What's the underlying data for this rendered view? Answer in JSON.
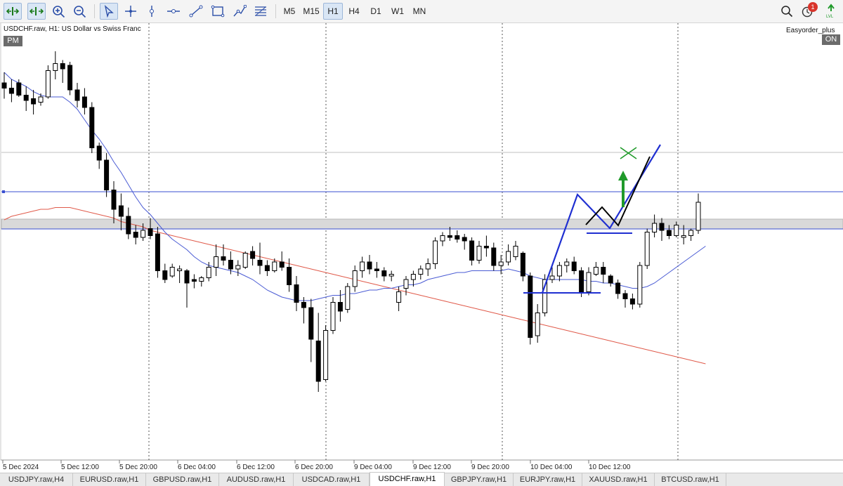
{
  "toolbar": {
    "tools": [
      {
        "name": "autoscroll-icon"
      },
      {
        "name": "chart-shift-icon"
      },
      {
        "name": "zoom-in-icon"
      },
      {
        "name": "zoom-out-icon"
      },
      {
        "name": "cursor-icon"
      },
      {
        "name": "crosshair-icon"
      },
      {
        "name": "vertical-line-icon"
      },
      {
        "name": "horizontal-line-icon"
      },
      {
        "name": "trendline-icon"
      },
      {
        "name": "rectangle-icon"
      },
      {
        "name": "polyline-icon"
      },
      {
        "name": "fibonacci-icon"
      }
    ],
    "timeframes": [
      "M5",
      "M15",
      "H1",
      "H4",
      "D1",
      "W1",
      "MN"
    ],
    "active_timeframe": "H1",
    "notification_count": "1"
  },
  "chart": {
    "title": "USDCHF.raw, H1:  US Dollar vs Swiss Franc",
    "session_badge": "PM",
    "expert_name": "Easyorder_plus",
    "expert_status": "ON",
    "time_labels": [
      "5 Dec 2024",
      "5 Dec 12:00",
      "5 Dec 20:00",
      "6 Dec 04:00",
      "6 Dec 12:00",
      "6 Dec 20:00",
      "9 Dec 04:00",
      "9 Dec 12:00",
      "9 Dec 20:00",
      "10 Dec 04:00",
      "10 Dec 12:00"
    ]
  },
  "tabs": [
    "USDJPY.raw,H4",
    "EURUSD.raw,H1",
    "GBPUSD.raw,H1",
    "AUDUSD.raw,H1",
    "USDCAD.raw,H1",
    "USDCHF.raw,H1",
    "GBPJPY.raw,H1",
    "EURJPY.raw,H1",
    "XAUUSD.raw,H1",
    "BTCUSD.raw,H1"
  ],
  "active_tab": "USDCHF.raw,H1",
  "colors": {
    "bull": "#ffffff",
    "bear": "#000000",
    "fast_ma": "#4a5bd4",
    "slow_ma": "#e05a4a",
    "h_level": "#3a4fd0",
    "zone_fill": "#d9d9d9",
    "drawing_blue": "#1f2fd1",
    "drawing_black": "#000000",
    "target_green": "#1f9a2a"
  },
  "chart_data": {
    "type": "candlestick",
    "symbol": "USDCHF.raw",
    "timeframe": "H1",
    "candles": [
      {
        "o": 0.8826,
        "h": 0.8832,
        "l": 0.8817,
        "c": 0.8823
      },
      {
        "o": 0.8823,
        "h": 0.8828,
        "l": 0.8815,
        "c": 0.882
      },
      {
        "o": 0.8826,
        "h": 0.8828,
        "l": 0.8818,
        "c": 0.8819
      },
      {
        "o": 0.8819,
        "h": 0.8824,
        "l": 0.881,
        "c": 0.8816
      },
      {
        "o": 0.8817,
        "h": 0.8822,
        "l": 0.8808,
        "c": 0.8814
      },
      {
        "o": 0.8815,
        "h": 0.882,
        "l": 0.8813,
        "c": 0.8818
      },
      {
        "o": 0.8818,
        "h": 0.8836,
        "l": 0.8817,
        "c": 0.8833
      },
      {
        "o": 0.8833,
        "h": 0.8844,
        "l": 0.8828,
        "c": 0.8837
      },
      {
        "o": 0.8837,
        "h": 0.8839,
        "l": 0.8826,
        "c": 0.8834
      },
      {
        "o": 0.8836,
        "h": 0.8838,
        "l": 0.8819,
        "c": 0.8822
      },
      {
        "o": 0.8822,
        "h": 0.8826,
        "l": 0.8812,
        "c": 0.8816
      },
      {
        "o": 0.8818,
        "h": 0.8823,
        "l": 0.8808,
        "c": 0.8812
      },
      {
        "o": 0.8812,
        "h": 0.8815,
        "l": 0.8786,
        "c": 0.8789
      },
      {
        "o": 0.879,
        "h": 0.8792,
        "l": 0.8777,
        "c": 0.8782
      },
      {
        "o": 0.8782,
        "h": 0.8786,
        "l": 0.8761,
        "c": 0.8765
      },
      {
        "o": 0.8765,
        "h": 0.877,
        "l": 0.8746,
        "c": 0.8754
      },
      {
        "o": 0.8756,
        "h": 0.8763,
        "l": 0.8742,
        "c": 0.875
      },
      {
        "o": 0.875,
        "h": 0.8755,
        "l": 0.8737,
        "c": 0.874
      },
      {
        "o": 0.8741,
        "h": 0.8745,
        "l": 0.8734,
        "c": 0.8738
      },
      {
        "o": 0.8738,
        "h": 0.8746,
        "l": 0.8736,
        "c": 0.8742
      },
      {
        "o": 0.8743,
        "h": 0.8749,
        "l": 0.8737,
        "c": 0.8739
      },
      {
        "o": 0.874,
        "h": 0.8744,
        "l": 0.8715,
        "c": 0.8719
      },
      {
        "o": 0.8719,
        "h": 0.8723,
        "l": 0.8712,
        "c": 0.8714
      },
      {
        "o": 0.8716,
        "h": 0.8723,
        "l": 0.8715,
        "c": 0.8721
      },
      {
        "o": 0.8719,
        "h": 0.8722,
        "l": 0.8712,
        "c": 0.872
      },
      {
        "o": 0.8719,
        "h": 0.872,
        "l": 0.8698,
        "c": 0.8712
      },
      {
        "o": 0.8714,
        "h": 0.8717,
        "l": 0.8709,
        "c": 0.8713
      },
      {
        "o": 0.8713,
        "h": 0.8716,
        "l": 0.871,
        "c": 0.8715
      },
      {
        "o": 0.8715,
        "h": 0.8724,
        "l": 0.8713,
        "c": 0.8721
      },
      {
        "o": 0.8721,
        "h": 0.8734,
        "l": 0.8716,
        "c": 0.8727
      },
      {
        "o": 0.8727,
        "h": 0.8734,
        "l": 0.8722,
        "c": 0.8725
      },
      {
        "o": 0.8725,
        "h": 0.873,
        "l": 0.8717,
        "c": 0.872
      },
      {
        "o": 0.872,
        "h": 0.8725,
        "l": 0.8716,
        "c": 0.8722
      },
      {
        "o": 0.8721,
        "h": 0.873,
        "l": 0.872,
        "c": 0.8729
      },
      {
        "o": 0.873,
        "h": 0.8733,
        "l": 0.8722,
        "c": 0.8726
      },
      {
        "o": 0.8725,
        "h": 0.8735,
        "l": 0.8717,
        "c": 0.8722
      },
      {
        "o": 0.8722,
        "h": 0.8725,
        "l": 0.8716,
        "c": 0.8719
      },
      {
        "o": 0.8719,
        "h": 0.8726,
        "l": 0.8718,
        "c": 0.8724
      },
      {
        "o": 0.8724,
        "h": 0.873,
        "l": 0.8719,
        "c": 0.8721
      },
      {
        "o": 0.8721,
        "h": 0.8726,
        "l": 0.8707,
        "c": 0.8711
      },
      {
        "o": 0.8711,
        "h": 0.8716,
        "l": 0.8696,
        "c": 0.8701
      },
      {
        "o": 0.8701,
        "h": 0.8704,
        "l": 0.8689,
        "c": 0.8698
      },
      {
        "o": 0.8698,
        "h": 0.8703,
        "l": 0.8667,
        "c": 0.868
      },
      {
        "o": 0.8679,
        "h": 0.8695,
        "l": 0.865,
        "c": 0.8656
      },
      {
        "o": 0.8657,
        "h": 0.8688,
        "l": 0.8656,
        "c": 0.8685
      },
      {
        "o": 0.8685,
        "h": 0.8704,
        "l": 0.8683,
        "c": 0.8701
      },
      {
        "o": 0.8701,
        "h": 0.8708,
        "l": 0.869,
        "c": 0.8696
      },
      {
        "o": 0.8697,
        "h": 0.8712,
        "l": 0.8695,
        "c": 0.871
      },
      {
        "o": 0.871,
        "h": 0.8722,
        "l": 0.8707,
        "c": 0.8719
      },
      {
        "o": 0.8719,
        "h": 0.8727,
        "l": 0.8715,
        "c": 0.8724
      },
      {
        "o": 0.8724,
        "h": 0.8728,
        "l": 0.8717,
        "c": 0.872
      },
      {
        "o": 0.872,
        "h": 0.8724,
        "l": 0.8715,
        "c": 0.8719
      },
      {
        "o": 0.8719,
        "h": 0.8721,
        "l": 0.8713,
        "c": 0.8716
      },
      {
        "o": 0.8716,
        "h": 0.8719,
        "l": 0.8713,
        "c": 0.8717
      },
      {
        "o": 0.8701,
        "h": 0.871,
        "l": 0.8696,
        "c": 0.8707
      },
      {
        "o": 0.8709,
        "h": 0.8716,
        "l": 0.8705,
        "c": 0.8714
      },
      {
        "o": 0.8714,
        "h": 0.8719,
        "l": 0.871,
        "c": 0.8717
      },
      {
        "o": 0.8717,
        "h": 0.8722,
        "l": 0.8714,
        "c": 0.872
      },
      {
        "o": 0.872,
        "h": 0.8726,
        "l": 0.8716,
        "c": 0.8723
      },
      {
        "o": 0.8723,
        "h": 0.8738,
        "l": 0.872,
        "c": 0.8736
      },
      {
        "o": 0.8736,
        "h": 0.8741,
        "l": 0.8733,
        "c": 0.8739
      },
      {
        "o": 0.8739,
        "h": 0.8744,
        "l": 0.8736,
        "c": 0.8738
      },
      {
        "o": 0.8739,
        "h": 0.8742,
        "l": 0.8735,
        "c": 0.8737
      },
      {
        "o": 0.8738,
        "h": 0.874,
        "l": 0.8731,
        "c": 0.8736
      },
      {
        "o": 0.8736,
        "h": 0.8738,
        "l": 0.8722,
        "c": 0.8725
      },
      {
        "o": 0.8725,
        "h": 0.8736,
        "l": 0.8723,
        "c": 0.8733
      },
      {
        "o": 0.8733,
        "h": 0.8739,
        "l": 0.8727,
        "c": 0.8732
      },
      {
        "o": 0.8732,
        "h": 0.8735,
        "l": 0.8719,
        "c": 0.8722
      },
      {
        "o": 0.8722,
        "h": 0.8728,
        "l": 0.8717,
        "c": 0.8724
      },
      {
        "o": 0.8724,
        "h": 0.8734,
        "l": 0.8722,
        "c": 0.873
      },
      {
        "o": 0.8727,
        "h": 0.8736,
        "l": 0.8725,
        "c": 0.8733
      },
      {
        "o": 0.8729,
        "h": 0.873,
        "l": 0.8713,
        "c": 0.8716
      },
      {
        "o": 0.8716,
        "h": 0.8718,
        "l": 0.8677,
        "c": 0.8681
      },
      {
        "o": 0.8682,
        "h": 0.87,
        "l": 0.8678,
        "c": 0.8695
      },
      {
        "o": 0.8695,
        "h": 0.8717,
        "l": 0.8693,
        "c": 0.8714
      },
      {
        "o": 0.8714,
        "h": 0.8721,
        "l": 0.8712,
        "c": 0.8716
      },
      {
        "o": 0.8716,
        "h": 0.8724,
        "l": 0.8713,
        "c": 0.8722
      },
      {
        "o": 0.8722,
        "h": 0.8726,
        "l": 0.8718,
        "c": 0.8724
      },
      {
        "o": 0.8724,
        "h": 0.8727,
        "l": 0.8717,
        "c": 0.8719
      },
      {
        "o": 0.8719,
        "h": 0.8721,
        "l": 0.8704,
        "c": 0.8707
      },
      {
        "o": 0.8707,
        "h": 0.8721,
        "l": 0.8705,
        "c": 0.8718
      },
      {
        "o": 0.8717,
        "h": 0.8724,
        "l": 0.8716,
        "c": 0.8721
      },
      {
        "o": 0.8721,
        "h": 0.8724,
        "l": 0.8712,
        "c": 0.8717
      },
      {
        "o": 0.8716,
        "h": 0.8717,
        "l": 0.871,
        "c": 0.8712
      },
      {
        "o": 0.8712,
        "h": 0.8714,
        "l": 0.8703,
        "c": 0.8706
      },
      {
        "o": 0.8706,
        "h": 0.8708,
        "l": 0.8698,
        "c": 0.8703
      },
      {
        "o": 0.8703,
        "h": 0.8706,
        "l": 0.8697,
        "c": 0.87
      },
      {
        "o": 0.87,
        "h": 0.8724,
        "l": 0.8698,
        "c": 0.8722
      },
      {
        "o": 0.8722,
        "h": 0.8743,
        "l": 0.872,
        "c": 0.8741
      },
      {
        "o": 0.8741,
        "h": 0.8751,
        "l": 0.8738,
        "c": 0.8746
      },
      {
        "o": 0.8746,
        "h": 0.8749,
        "l": 0.8736,
        "c": 0.8742
      },
      {
        "o": 0.8742,
        "h": 0.8745,
        "l": 0.8737,
        "c": 0.8739
      },
      {
        "o": 0.8739,
        "h": 0.8747,
        "l": 0.8738,
        "c": 0.8745
      },
      {
        "o": 0.8738,
        "h": 0.8745,
        "l": 0.8734,
        "c": 0.8739
      },
      {
        "o": 0.8739,
        "h": 0.8743,
        "l": 0.8736,
        "c": 0.8742
      },
      {
        "o": 0.8742,
        "h": 0.8763,
        "l": 0.874,
        "c": 0.8758
      }
    ],
    "fast_ma": [
      0.8832,
      0.8828,
      0.8826,
      0.8824,
      0.8821,
      0.8819,
      0.8818,
      0.8818,
      0.8818,
      0.8815,
      0.8811,
      0.8805,
      0.8799,
      0.8794,
      0.8788,
      0.8781,
      0.8775,
      0.8768,
      0.8761,
      0.8755,
      0.8751,
      0.8746,
      0.8741,
      0.8737,
      0.8734,
      0.8731,
      0.8727,
      0.8724,
      0.8722,
      0.8721,
      0.872,
      0.8719,
      0.8718,
      0.8716,
      0.8714,
      0.8711,
      0.8708,
      0.8706,
      0.8704,
      0.8703,
      0.8702,
      0.8702,
      0.8702,
      0.8703,
      0.8704,
      0.8705,
      0.8705,
      0.8706,
      0.8706,
      0.8707,
      0.8708,
      0.8708,
      0.8709,
      0.8709,
      0.871,
      0.8711,
      0.8711,
      0.8712,
      0.8714,
      0.8715,
      0.8716,
      0.8717,
      0.8718,
      0.8718,
      0.8719,
      0.8719,
      0.8719,
      0.8719,
      0.8719,
      0.872,
      0.8719,
      0.8718,
      0.8716,
      0.8715,
      0.8714,
      0.8714,
      0.8714,
      0.8714,
      0.8714,
      0.8714,
      0.8713,
      0.8713,
      0.8712,
      0.8712,
      0.8711,
      0.871,
      0.8709,
      0.8709,
      0.871,
      0.8712,
      0.8715,
      0.8718,
      0.8721,
      0.8724,
      0.8727,
      0.873,
      0.8733
    ],
    "slow_ma": [
      0.8748,
      0.875,
      0.8751,
      0.8752,
      0.8753,
      0.8754,
      0.8754,
      0.8755,
      0.8755,
      0.8755,
      0.8754,
      0.8753,
      0.8752,
      0.8751,
      0.875,
      0.8749,
      0.8747,
      0.8746,
      0.8745,
      0.8744,
      0.8742,
      0.8741,
      0.874,
      0.8739,
      0.8738,
      0.8737,
      0.8736,
      0.8735,
      0.8734,
      0.8733,
      0.8732,
      0.8731,
      0.873,
      0.8729,
      0.8728,
      0.8727,
      0.8726,
      0.8725,
      0.8724,
      0.8723,
      0.8722,
      0.8721,
      0.872,
      0.8719,
      0.8718,
      0.8717,
      0.8716,
      0.8715,
      0.8714,
      0.8713,
      0.8712,
      0.8711,
      0.871,
      0.8709,
      0.8708,
      0.8707,
      0.8706,
      0.8705,
      0.8704,
      0.8703,
      0.8702,
      0.8701,
      0.87,
      0.8699,
      0.8698,
      0.8697,
      0.8696,
      0.8695,
      0.8694,
      0.8693,
      0.8692,
      0.8691,
      0.869,
      0.8689,
      0.8688,
      0.8687,
      0.8686,
      0.8685,
      0.8684,
      0.8683,
      0.8682,
      0.8681,
      0.868,
      0.8679,
      0.8678,
      0.8677,
      0.8676,
      0.8675,
      0.8674,
      0.8673,
      0.8672,
      0.8671,
      0.867,
      0.8669,
      0.8668,
      0.8667,
      0.8666
    ]
  }
}
